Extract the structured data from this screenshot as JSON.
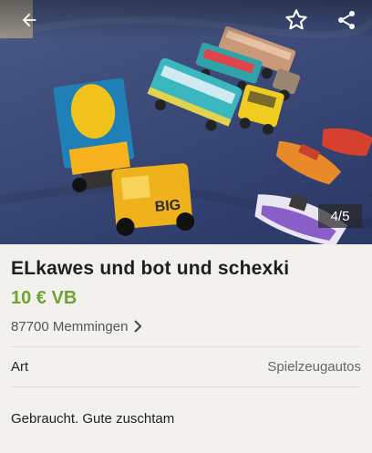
{
  "photo": {
    "counter": "4/5",
    "alt": "Spielzeugautos Foto"
  },
  "topbar": {
    "back_icon": "arrow-back-icon",
    "favorite_icon": "star-outline-icon",
    "share_icon": "share-icon"
  },
  "listing": {
    "title": "ELkawes und bot und schexki",
    "price": "10 € VB",
    "location": "87700 Memmingen"
  },
  "attributes": [
    {
      "label": "Art",
      "value": "Spielzeugautos"
    }
  ],
  "description": "Gebraucht. Gute zuschtam",
  "colors": {
    "price": "#6ea431",
    "background": "#f2f1ee"
  }
}
